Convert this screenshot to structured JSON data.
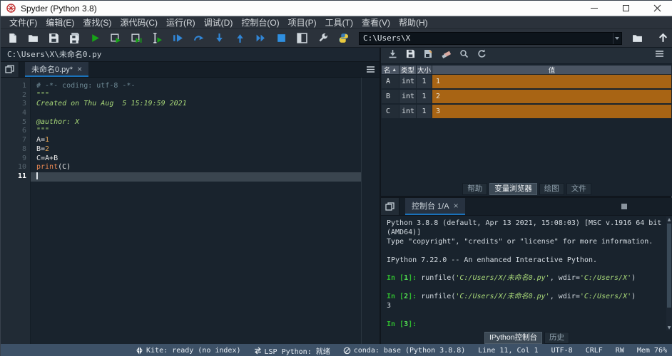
{
  "colors": {
    "accent_blue": "#1a72bb",
    "run_green": "#17a317",
    "debug_blue": "#3186d6",
    "value_orange": "#a86414",
    "string_green": "#a8d878",
    "number_orange": "#e1a153",
    "builtin_orange": "#e88752",
    "comment_teal": "#6c8793",
    "panel_bg": "#19232d",
    "chrome_bg": "#2b323b",
    "statusbar_bg": "#3d5167",
    "titlebar_bg": "#fdfdfd"
  },
  "window": {
    "title": "Spyder (Python 3.8)"
  },
  "menu": [
    "文件(F)",
    "编辑(E)",
    "查找(S)",
    "源代码(C)",
    "运行(R)",
    "调试(D)",
    "控制台(O)",
    "项目(P)",
    "工具(T)",
    "查看(V)",
    "帮助(H)"
  ],
  "toolbar": {
    "items": [
      {
        "name": "new-file-button",
        "icon": "new-file-icon"
      },
      {
        "name": "open-file-button",
        "icon": "open-folder-icon"
      },
      {
        "name": "save-button",
        "icon": "save-icon"
      },
      {
        "name": "save-all-button",
        "icon": "save-all-icon"
      },
      {
        "name": "run-button",
        "icon": "run-icon"
      },
      {
        "name": "run-cell-button",
        "icon": "run-cell-icon"
      },
      {
        "name": "run-cell-advance-button",
        "icon": "run-cell-advance-icon"
      },
      {
        "name": "run-selection-button",
        "icon": "run-selection-icon"
      },
      {
        "name": "debug-button",
        "icon": "debug-icon"
      },
      {
        "name": "step-over-button",
        "icon": "step-over-icon"
      },
      {
        "name": "step-into-button",
        "icon": "step-into-icon"
      },
      {
        "name": "step-out-button",
        "icon": "step-out-icon"
      },
      {
        "name": "continue-button",
        "icon": "continue-icon"
      },
      {
        "name": "stop-button",
        "icon": "stop-icon"
      },
      {
        "name": "maximize-pane-button",
        "icon": "maximize-pane-icon"
      },
      {
        "name": "preferences-button",
        "icon": "wrench-icon"
      },
      {
        "name": "pythonpath-button",
        "icon": "python-logo-icon"
      }
    ],
    "path_value": "C:\\Users\\X"
  },
  "editor": {
    "breadcrumb": "C:\\Users\\X\\未命名0.py",
    "tab": {
      "label": "未命名0.py*",
      "close_glyph": "×"
    },
    "current_line": 11,
    "lines": [
      {
        "n": 1,
        "segs": [
          {
            "t": "# -*- coding: utf-8 -*-",
            "c": "comment"
          }
        ]
      },
      {
        "n": 2,
        "segs": [
          {
            "t": "\"\"\"",
            "c": "string"
          }
        ]
      },
      {
        "n": 3,
        "segs": [
          {
            "t": "Created on Thu Aug  5 15:19:59 2021",
            "c": "string"
          }
        ]
      },
      {
        "n": 4,
        "segs": []
      },
      {
        "n": 5,
        "segs": [
          {
            "t": "@author: X",
            "c": "string"
          }
        ]
      },
      {
        "n": 6,
        "segs": [
          {
            "t": "\"\"\"",
            "c": "string"
          }
        ]
      },
      {
        "n": 7,
        "segs": [
          {
            "t": "A=",
            "c": "normal"
          },
          {
            "t": "1",
            "c": "number"
          }
        ]
      },
      {
        "n": 8,
        "segs": [
          {
            "t": "B=",
            "c": "normal"
          },
          {
            "t": "2",
            "c": "number"
          }
        ]
      },
      {
        "n": 9,
        "segs": [
          {
            "t": "C=A+B",
            "c": "normal"
          }
        ]
      },
      {
        "n": 10,
        "segs": [
          {
            "t": "print",
            "c": "builtin"
          },
          {
            "t": "(C)",
            "c": "normal"
          }
        ]
      },
      {
        "n": 11,
        "segs": []
      }
    ]
  },
  "variable_explorer": {
    "toolbar": [
      {
        "name": "import-data-button",
        "icon": "import-icon"
      },
      {
        "name": "save-data-button",
        "icon": "save-icon"
      },
      {
        "name": "save-data-as-button",
        "icon": "save-as-icon"
      },
      {
        "name": "remove-variables-button",
        "icon": "eraser-icon"
      },
      {
        "name": "search-button",
        "icon": "search-icon"
      },
      {
        "name": "refresh-button",
        "icon": "refresh-icon"
      }
    ],
    "columns": [
      "名",
      "类型",
      "大小",
      "值"
    ],
    "rows": [
      {
        "name": "A",
        "type": "int",
        "size": "1",
        "value": "1"
      },
      {
        "name": "B",
        "type": "int",
        "size": "1",
        "value": "2"
      },
      {
        "name": "C",
        "type": "int",
        "size": "1",
        "value": "3"
      }
    ],
    "pane_tabs": [
      {
        "label": "帮助",
        "selected": false
      },
      {
        "label": "变量浏览器",
        "selected": true
      },
      {
        "label": "绘图",
        "selected": false
      },
      {
        "label": "文件",
        "selected": false
      }
    ]
  },
  "console": {
    "tab_label": "控制台 1/A",
    "close_glyph": "×",
    "header_buttons": [
      {
        "name": "interrupt-kernel-button",
        "icon": "square-icon"
      },
      {
        "name": "close-console-button",
        "icon": "trash-icon"
      },
      {
        "name": "console-options-button",
        "icon": "hamburger-icon"
      }
    ],
    "lines": [
      {
        "segs": [
          {
            "t": "Python 3.8.8 (default, Apr 13 2021, 15:08:03) [MSC v.1916 64 bit",
            "c": "out"
          }
        ]
      },
      {
        "segs": [
          {
            "t": "(AMD64)]",
            "c": "out"
          }
        ]
      },
      {
        "segs": [
          {
            "t": "Type \"copyright\", \"credits\" or \"license\" for more information.",
            "c": "out"
          }
        ]
      },
      {
        "segs": []
      },
      {
        "segs": [
          {
            "t": "IPython 7.22.0 -- An enhanced Interactive Python.",
            "c": "out"
          }
        ]
      },
      {
        "segs": []
      },
      {
        "segs": [
          {
            "t": "In [",
            "c": "prompt"
          },
          {
            "t": "1",
            "c": "promptnum"
          },
          {
            "t": "]: ",
            "c": "prompt"
          },
          {
            "t": "runfile(",
            "c": "out"
          },
          {
            "t": "'C:/Users/X/未命名0.py'",
            "c": "str"
          },
          {
            "t": ", wdir=",
            "c": "out"
          },
          {
            "t": "'C:/Users/X'",
            "c": "str"
          },
          {
            "t": ")",
            "c": "out"
          }
        ]
      },
      {
        "segs": []
      },
      {
        "segs": [
          {
            "t": "In [",
            "c": "prompt"
          },
          {
            "t": "2",
            "c": "promptnum"
          },
          {
            "t": "]: ",
            "c": "prompt"
          },
          {
            "t": "runfile(",
            "c": "out"
          },
          {
            "t": "'C:/Users/X/未命名0.py'",
            "c": "str"
          },
          {
            "t": ", wdir=",
            "c": "out"
          },
          {
            "t": "'C:/Users/X'",
            "c": "str"
          },
          {
            "t": ")",
            "c": "out"
          }
        ]
      },
      {
        "segs": [
          {
            "t": "3",
            "c": "out"
          }
        ]
      },
      {
        "segs": []
      },
      {
        "segs": [
          {
            "t": "In [",
            "c": "prompt"
          },
          {
            "t": "3",
            "c": "promptnum"
          },
          {
            "t": "]: ",
            "c": "prompt"
          }
        ]
      }
    ],
    "bottom_tabs": [
      {
        "label": "IPython控制台",
        "selected": true
      },
      {
        "label": "历史",
        "selected": false
      }
    ]
  },
  "statusbar": {
    "items": [
      {
        "icon": "kite-icon",
        "text": "Kite: ready (no index)"
      },
      {
        "icon": "lsp-icon",
        "text": "LSP Python: 就绪"
      },
      {
        "icon": "conda-icon",
        "text": "conda: base (Python 3.8.8)"
      },
      {
        "text": "Line 11, Col 1"
      },
      {
        "text": "UTF-8"
      },
      {
        "text": "CRLF"
      },
      {
        "text": "RW"
      },
      {
        "text": "Mem 76%"
      }
    ]
  }
}
